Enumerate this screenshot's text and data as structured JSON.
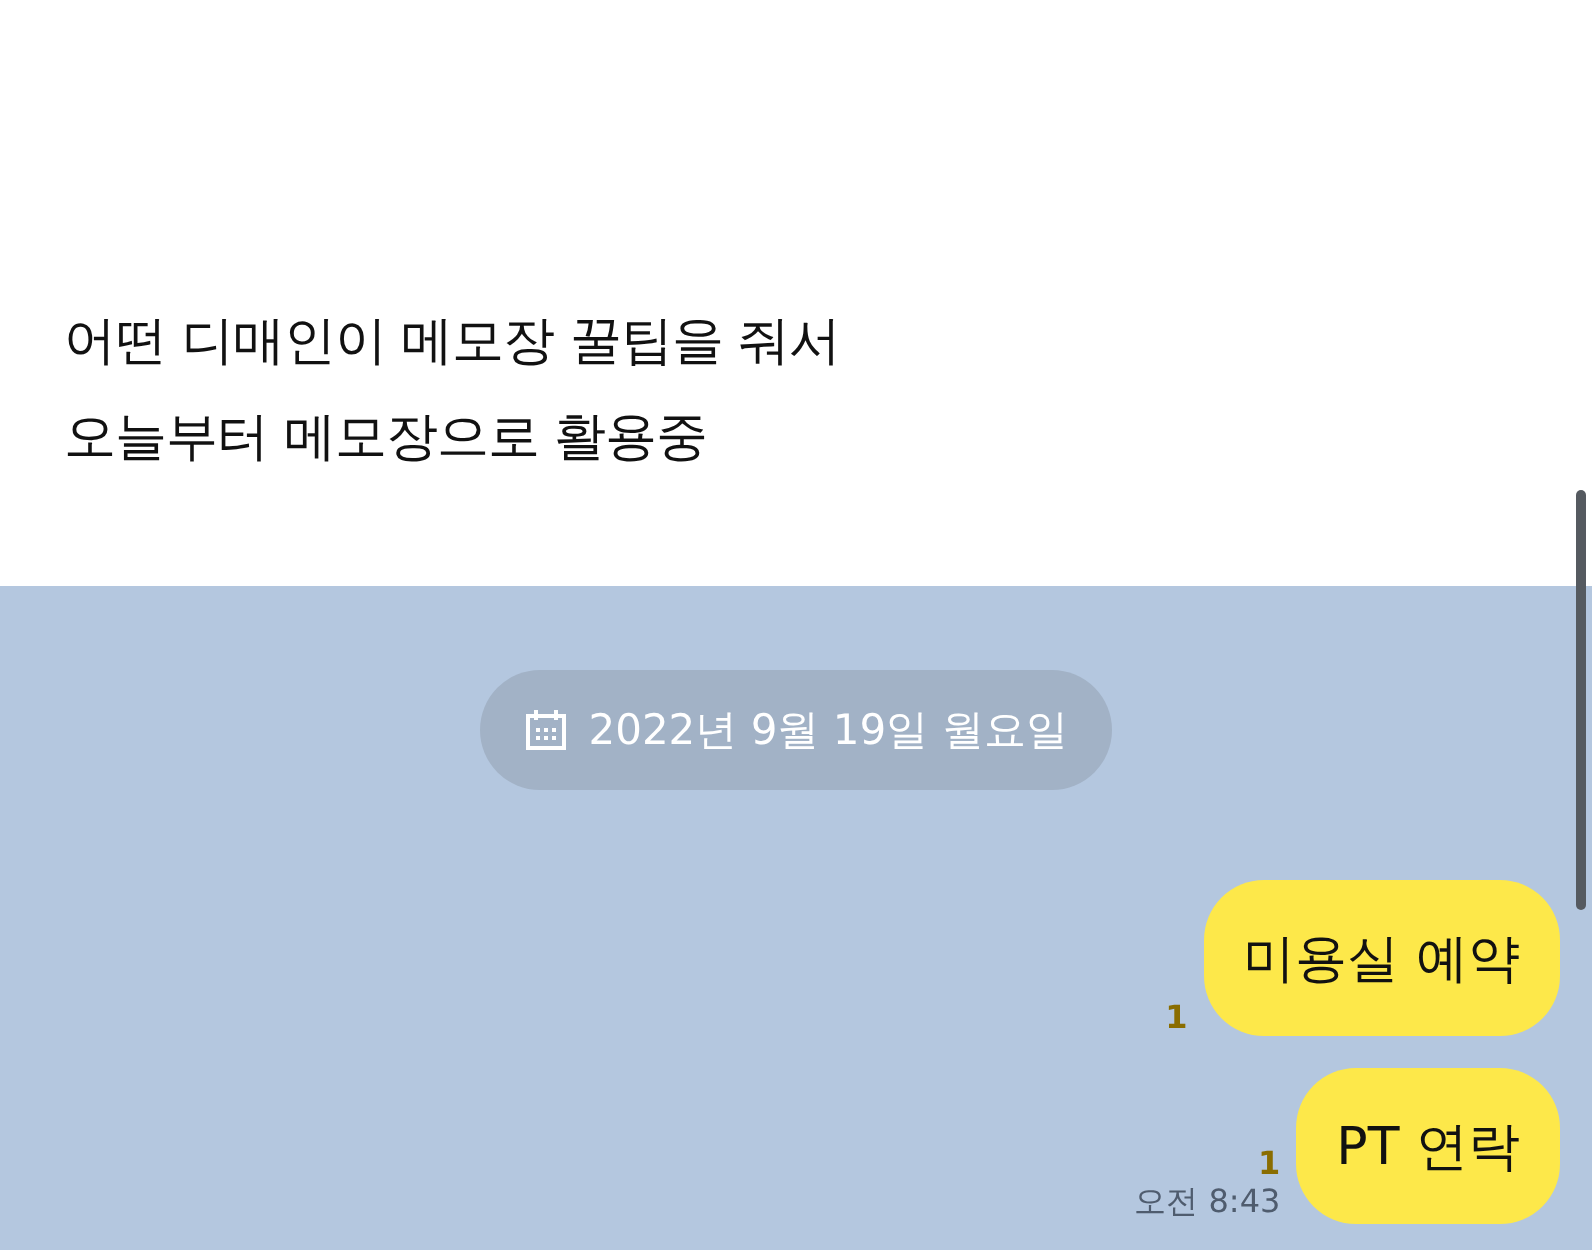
{
  "post": {
    "lines": [
      "어떤 디매인이 메모장 꿀팁을 줘서",
      "오늘부터 메모장으로 활용중"
    ]
  },
  "chat": {
    "date": "2022년 9월 19일 월요일",
    "messages": [
      {
        "text": "미용실 예약",
        "unread": "1"
      },
      {
        "text": "PT 연락",
        "unread": "1",
        "time": "오전 8:43"
      }
    ]
  }
}
